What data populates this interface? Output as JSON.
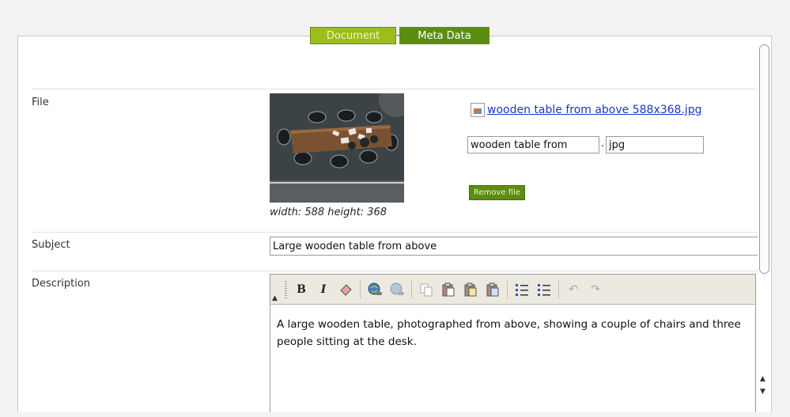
{
  "tabs": {
    "document": "Document",
    "meta_data": "Meta Data"
  },
  "file": {
    "label": "File",
    "image_dimensions": "width: 588 height: 368",
    "link_text": " wooden table from above 588x368.jpg",
    "name_value": "wooden table from",
    "ext_value": "jpg",
    "remove_button": "Remove file"
  },
  "subject": {
    "label": "Subject",
    "value": "Large wooden table from above"
  },
  "description": {
    "label": "Description",
    "text": "A large wooden table, photographed from above, showing a couple of chairs and three people sitting at the desk.",
    "toolbar": [
      "bold-icon",
      "italic-icon",
      "clear-formatting-icon",
      "insert-link-icon",
      "remove-link-icon",
      "copy-icon",
      "paste-icon",
      "paste-text-icon",
      "paste-word-icon",
      "ordered-list-icon",
      "unordered-list-icon",
      "undo-icon",
      "redo-icon"
    ]
  },
  "colors": {
    "tab_active": "#5b8d12",
    "tab_inactive": "#9cbd1a",
    "link": "#1c35c9"
  }
}
